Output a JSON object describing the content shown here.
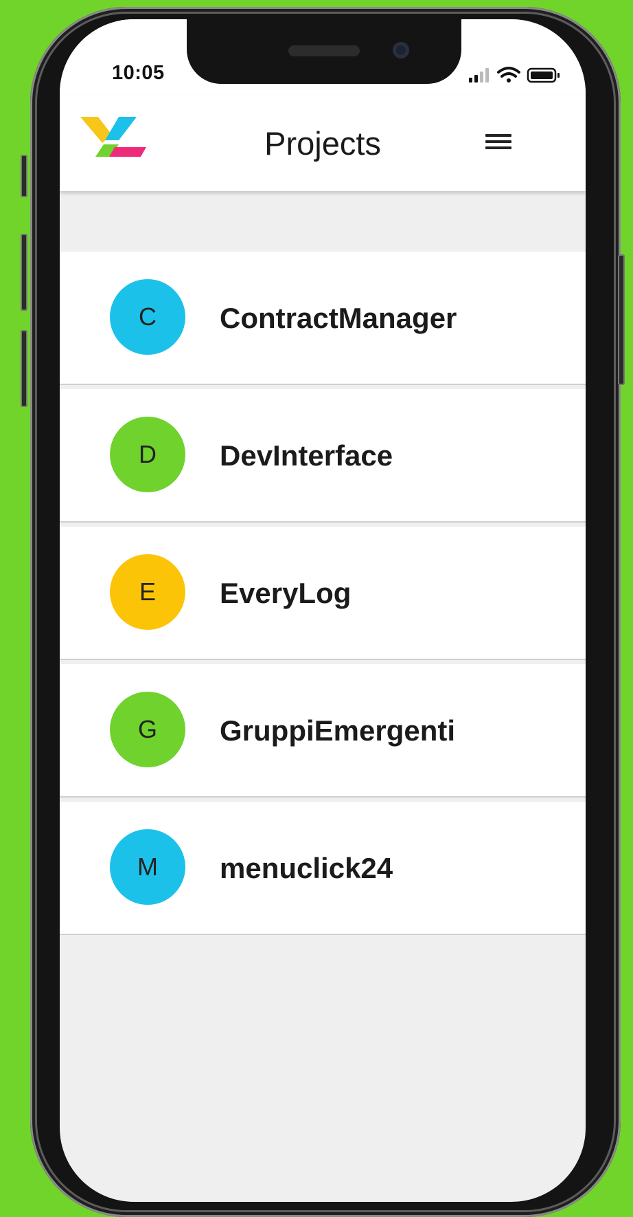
{
  "status_bar": {
    "time": "10:05",
    "icons": [
      "cellular-signal-icon",
      "wifi-icon",
      "battery-icon"
    ]
  },
  "header": {
    "title": "Projects",
    "logo_icon": "app-logo-icon",
    "menu_icon": "hamburger-menu-icon"
  },
  "projects": [
    {
      "initial": "C",
      "name": "ContractManager",
      "color": "#1cc1ea"
    },
    {
      "initial": "D",
      "name": "DevInterface",
      "color": "#6fd22d"
    },
    {
      "initial": "E",
      "name": "EveryLog",
      "color": "#fcc407"
    },
    {
      "initial": "G",
      "name": "GruppiEmergenti",
      "color": "#6fd22d"
    },
    {
      "initial": "M",
      "name": "menuclick24",
      "color": "#1cc1ea"
    }
  ],
  "colors": {
    "background": "#71d42b",
    "logo_yellow": "#f6c71a",
    "logo_blue": "#1cc1ea",
    "logo_green": "#6fd22d",
    "logo_pink": "#ee2a7b"
  }
}
